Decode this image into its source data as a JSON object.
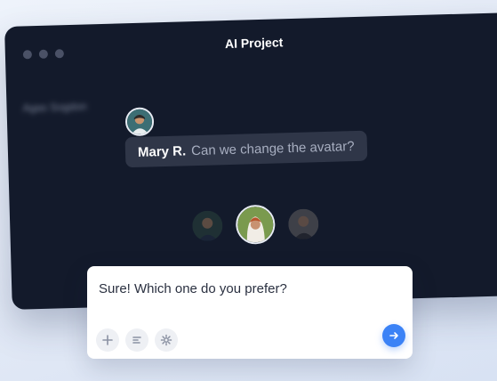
{
  "window": {
    "title": "AI Project",
    "blurred_label": "Agas Sogdon"
  },
  "chat": {
    "sender_name": "Mary R.",
    "message": "Can we change the avatar?"
  },
  "composer": {
    "text": "Sure! Which one do you prefer?",
    "tools": [
      "plus-icon",
      "text-lines-icon",
      "gear-icon"
    ],
    "send_icon": "arrow-right-icon"
  },
  "colors": {
    "window_bg": "#131a2b",
    "bubble_bg": "#2f3648",
    "accent": "#3b82f6"
  }
}
